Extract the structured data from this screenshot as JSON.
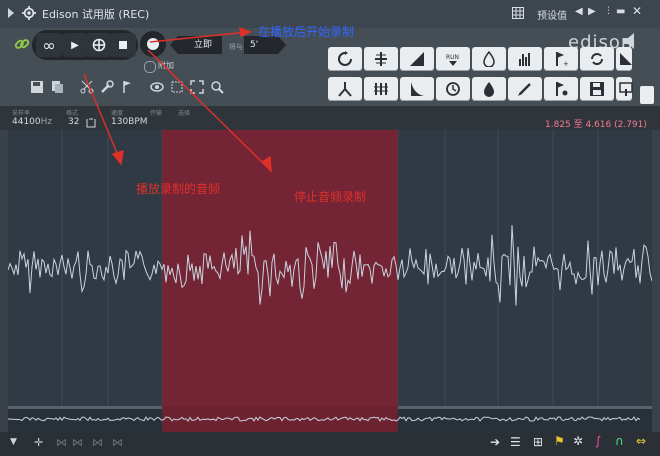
{
  "window": {
    "title": "Edison 试用版 (REC)",
    "preset_label": "预设值"
  },
  "toolbar": {
    "field_left": "立即",
    "field_left_suffix": "将与",
    "field_right": "5'",
    "append_label": "附加",
    "logo": "edison"
  },
  "info": {
    "labels": [
      "采样率",
      "格式",
      "速度",
      "传输",
      "选择"
    ],
    "sample_rate": "44100",
    "sample_rate_unit": "Hz",
    "format": "32",
    "tempo": "130BPM",
    "selection_range": "1.825 至 4.616 (2.791)"
  },
  "annotations": {
    "top_right": "在播放后开始录制",
    "play_recorded": "播放录制的音频",
    "stop_recording": "停止音频录制"
  },
  "colors": {
    "selection": "#7a2434",
    "waveform": "#c9d4de",
    "annotation": "#e0302a",
    "selection_text": "#f07a8e"
  },
  "icons": {
    "loop": "infinity-icon",
    "play": "play-icon",
    "wheel": "shuttle-icon",
    "stop": "stop-icon",
    "record": "record-icon"
  }
}
